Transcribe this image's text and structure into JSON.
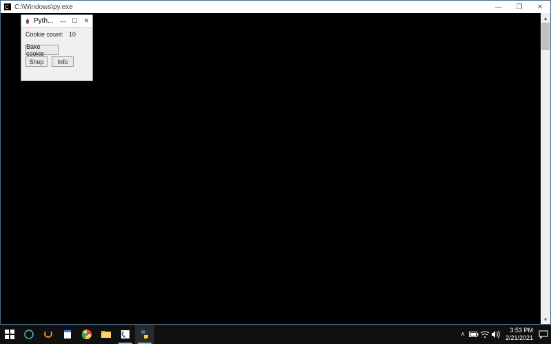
{
  "console": {
    "title": "C:\\Windows\\py.exe",
    "minimize": "—",
    "maximize": "❐",
    "close": "✕"
  },
  "tk": {
    "title": "Pyth...",
    "minimize": "—",
    "maximize": "☐",
    "close": "✕",
    "count_label": "Cookie count:",
    "count_value": "10",
    "bake_label": "Bake cookie",
    "shop_label": "Shop",
    "info_label": "Info"
  },
  "scrollbar": {
    "up": "▴",
    "down": "▾"
  },
  "tray": {
    "chevron": "˄",
    "battery": "▮",
    "wifi": "⏚",
    "volume": "🔊"
  },
  "clock": {
    "time": "3:53 PM",
    "date": "2/21/2021"
  }
}
